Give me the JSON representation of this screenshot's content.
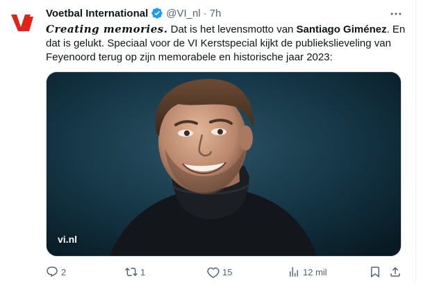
{
  "author": {
    "name": "Voetbal International",
    "handle": "@VI_nl",
    "separator": "·",
    "time": "7h",
    "verified_color": "#1d9bf0",
    "brand_color": "#e2231a"
  },
  "tweet": {
    "script_phrase": "Creating memories.",
    "text_part1": " Dat is het levensmotto van ",
    "bold_name": "Santiago Giménez",
    "text_part2": ". En dat is gelukt. Speciaal voor de VI Kerstspecial kijkt de publiekslieveling van Feyenoord terug op zijn memorabele en historische jaar 2023:"
  },
  "media": {
    "watermark": "vi.nl",
    "background_color": "#0f2f3d"
  },
  "actions": {
    "replies": "2",
    "reposts": "1",
    "likes": "15",
    "views": "12 mil"
  },
  "icons": {
    "more": "more-dots-icon",
    "reply": "reply-icon",
    "repost": "repost-icon",
    "like": "heart-icon",
    "views": "views-chart-icon",
    "bookmark": "bookmark-icon",
    "share": "share-icon"
  }
}
